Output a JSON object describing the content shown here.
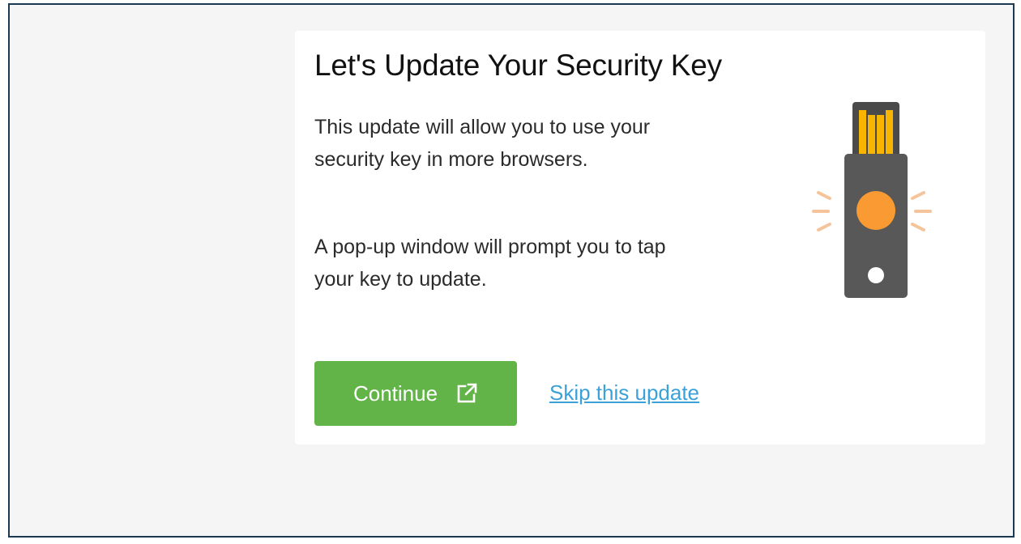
{
  "dialog": {
    "title": "Let's Update Your Security Key",
    "paragraph_1": "This update will allow you to use your security key in more browsers.",
    "paragraph_2": "A pop-up window will prompt you to tap your key to update."
  },
  "actions": {
    "continue_label": "Continue",
    "skip_label": "Skip this update"
  },
  "icons": {
    "continue_icon": "external-link-icon",
    "illustration": "security-key-icon"
  },
  "colors": {
    "continue_button": "#63b448",
    "link": "#3ba1d8",
    "key_body": "#555555",
    "key_button": "#f99a32",
    "key_contacts": "#f7b500",
    "glow": "#f6c49b"
  }
}
